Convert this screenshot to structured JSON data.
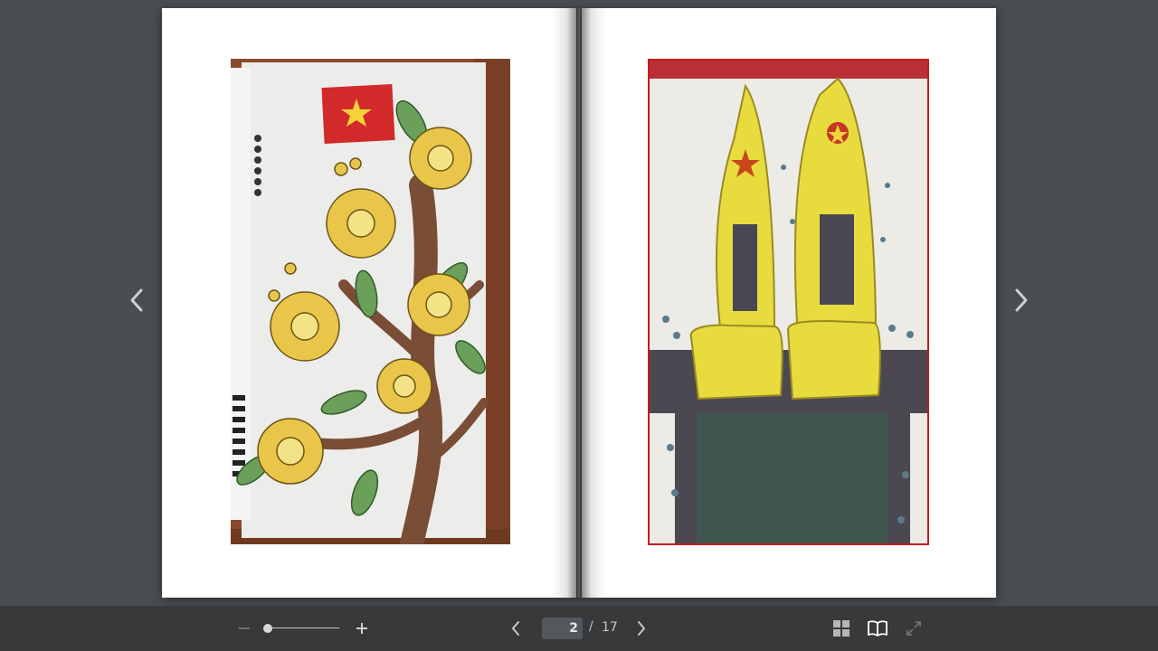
{
  "viewer": {
    "current_page": "2",
    "separator": "/",
    "total_pages": "17"
  },
  "zoom": {
    "level": 0.0
  },
  "icons": {
    "prev_page": "chevron-left-icon",
    "next_page": "chevron-right-icon",
    "zoom_out": "minus-icon",
    "zoom_in": "plus-icon",
    "thumbnails": "grid-icon",
    "book_view": "open-book-icon",
    "fullscreen": "fullscreen-icon"
  },
  "colors": {
    "background": "#4a4d50",
    "toolbar": "#37393b",
    "icon": "#c8c8c8",
    "icon_active": "#ffffff",
    "icon_disabled": "#6f7275"
  }
}
